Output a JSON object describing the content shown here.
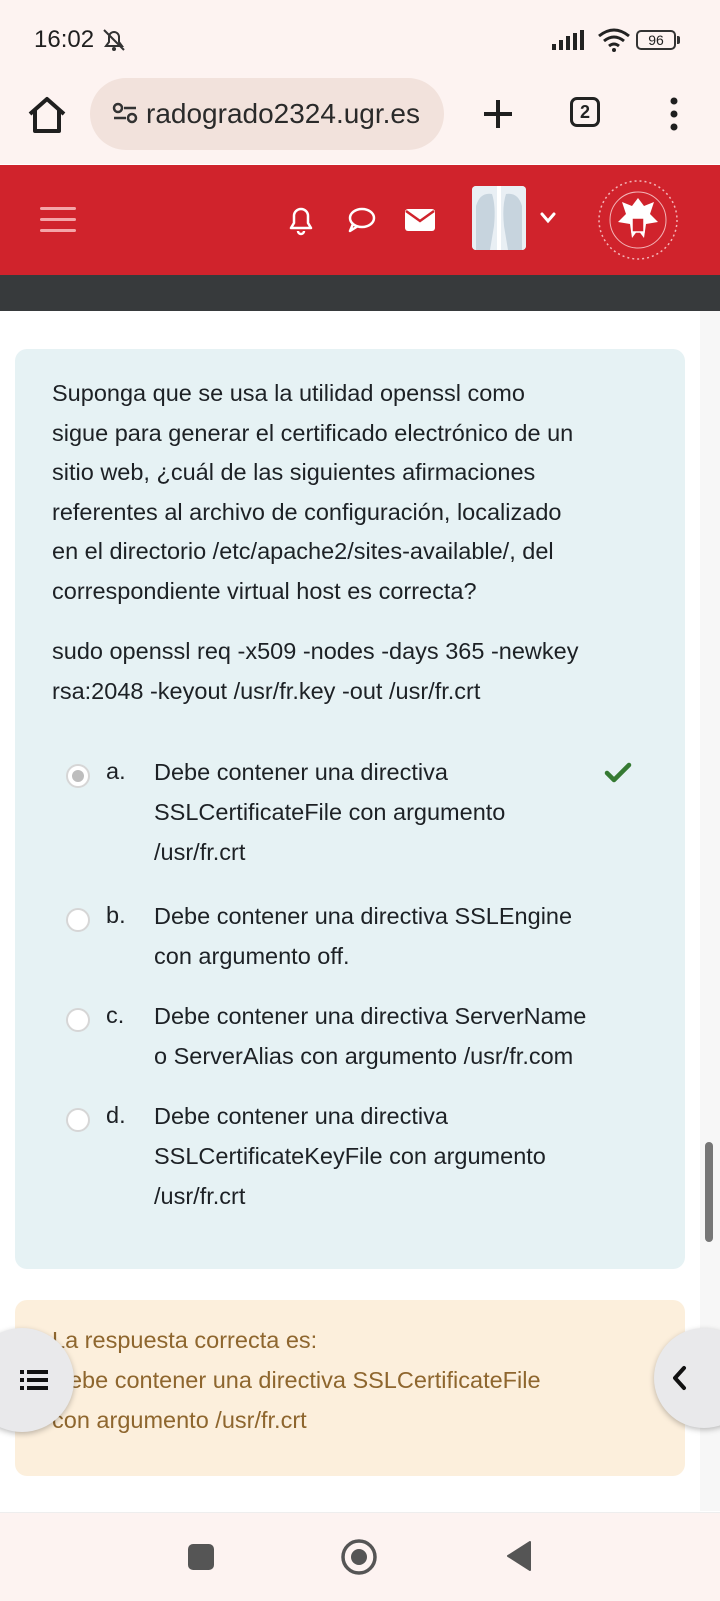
{
  "status_bar": {
    "time": "16:02",
    "battery": "96"
  },
  "browser": {
    "url": "radogrado2324.ugr.es",
    "tab_count": "2"
  },
  "question": {
    "lines": [
      "Suponga que se usa la utilidad openssl como",
      "sigue para generar el certificado electrónico de un",
      "sitio web, ¿cuál de las siguientes afirmaciones",
      "referentes al archivo de configuración, localizado",
      "en el directorio /etc/apache2/sites-available/, del",
      "correspondiente virtual host es correcta?"
    ],
    "command_lines": [
      "sudo openssl req -x509 -nodes -days 365 -newkey",
      "rsa:2048 -keyout /usr/fr.key -out /usr/fr.crt"
    ],
    "options": [
      {
        "letter": "a.",
        "lines": [
          "Debe contener una directiva",
          "SSLCertificateFile con argumento",
          "/usr/fr.crt"
        ],
        "selected": true,
        "correct": true
      },
      {
        "letter": "b.",
        "lines": [
          "Debe contener una directiva SSLEngine",
          "con argumento off."
        ],
        "selected": false
      },
      {
        "letter": "c.",
        "lines": [
          "Debe contener una directiva ServerName",
          "o ServerAlias con argumento /usr/fr.com"
        ],
        "selected": false
      },
      {
        "letter": "d.",
        "lines": [
          "Debe contener una directiva",
          "SSLCertificateKeyFile con argumento",
          "/usr/fr.crt"
        ],
        "selected": false
      }
    ]
  },
  "feedback": {
    "lines": [
      "La respuesta correcta es:",
      "Debe contener una directiva SSLCertificateFile",
      "con argumento /usr/fr.crt"
    ]
  },
  "colors": {
    "header_red": "#d0232c",
    "card_blue": "#e6f2f4",
    "feedback_bg": "#fcefdc",
    "feedback_text": "#8e662e",
    "check_green": "#357a32"
  }
}
